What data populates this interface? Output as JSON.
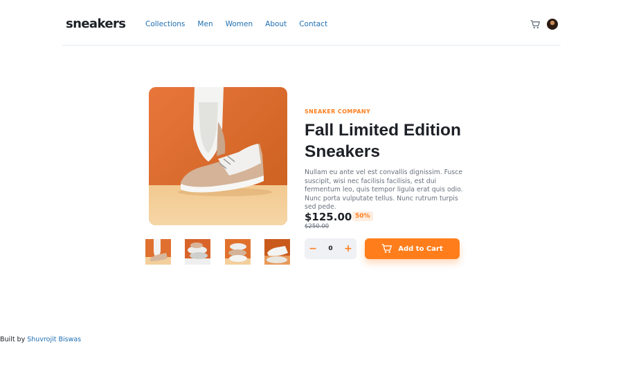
{
  "brand": {
    "logo": "sneakers"
  },
  "nav": [
    {
      "label": "Collections"
    },
    {
      "label": "Men"
    },
    {
      "label": "Women"
    },
    {
      "label": "About"
    },
    {
      "label": "Contact"
    }
  ],
  "header": {
    "cart_icon": "cart-icon",
    "avatar": "user-avatar"
  },
  "gallery": {
    "main_image": "white sneaker on orange background",
    "thumbnails_count": 4
  },
  "product": {
    "company": "SNEAKER COMPANY",
    "title": "Fall Limited Edition Sneakers",
    "description": "Nullam eu ante vel est convallis dignissim. Fusce suscipit, wisi nec facilisis facilisis, est dui fermentum leo, quis tempor ligula erat quis odio. Nunc porta vulputate tellus. Nunc rutrum turpis sed pede.",
    "price": "$125.00",
    "discount": "50%",
    "original_price": "$250.00"
  },
  "quantity": {
    "minus": "−",
    "value": "0",
    "plus": "+"
  },
  "cart_button": {
    "label": "Add to Cart",
    "icon": "cart-icon"
  },
  "footer": {
    "prefix": "Built by",
    "author": "Shuvrojit Biswas"
  },
  "colors": {
    "accent": "#ff7e1b",
    "accent_pale": "#ffede0",
    "link": "#1f6fb2",
    "text": "#1d2026",
    "muted": "#68707d"
  }
}
